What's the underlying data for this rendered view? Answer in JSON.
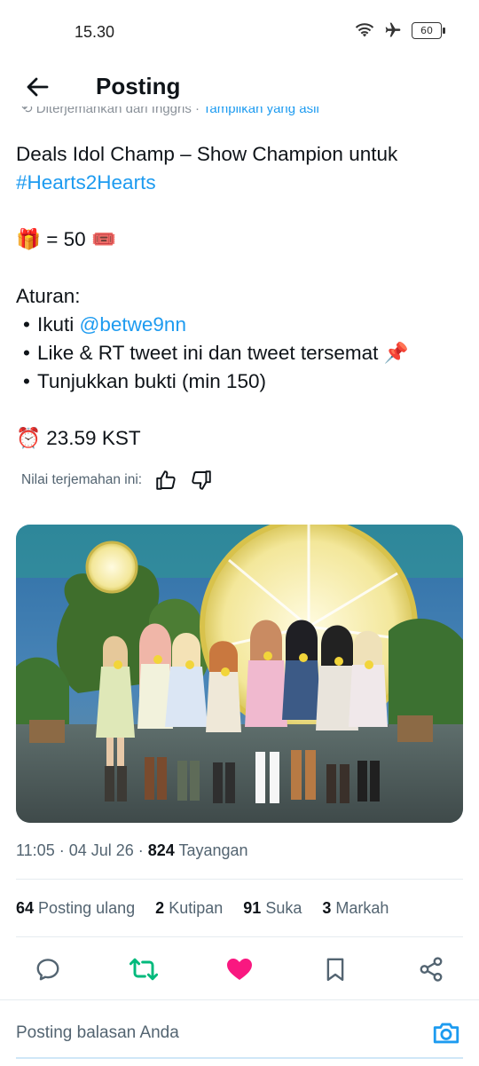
{
  "status_bar": {
    "time": "15.30",
    "battery": "60"
  },
  "header": {
    "title": "Posting"
  },
  "translation_strip": {
    "text": "Diterjemahkan dari Inggris · ",
    "link": "Tampilkan yang asli"
  },
  "tweet": {
    "line1": "Deals Idol Champ – Show Champion untuk",
    "hashtag": "#Hearts2Hearts",
    "gift_emoji": "🎁",
    "gift_text": " = 50 ",
    "ticket_emoji": "🎟️",
    "rules_title": "Aturan:",
    "rule1_prefix": "Ikuti ",
    "rule1_mention": "@betwe9nn",
    "rule2": "Like & RT tweet ini dan tweet tersemat ",
    "rule2_emoji": "📌",
    "rule3": "Tunjukkan bukti (min 150)",
    "deadline_emoji": "⏰",
    "deadline": " 23.59 KST"
  },
  "rate_translation": {
    "label": "Nilai terjemahan ini:"
  },
  "meta": {
    "time": "11:05 · 04 Jul 26 · ",
    "views_count": "824",
    "views_label": " Tayangan"
  },
  "stats": [
    {
      "count": "64",
      "label": "Posting ulang"
    },
    {
      "count": "2",
      "label": "Kutipan"
    },
    {
      "count": "91",
      "label": "Suka"
    },
    {
      "count": "3",
      "label": "Markah"
    }
  ],
  "reply": {
    "placeholder": "Posting balasan Anda"
  },
  "colors": {
    "link": "#1d9bf0",
    "retweet": "#00ba7c",
    "like": "#f91880"
  }
}
